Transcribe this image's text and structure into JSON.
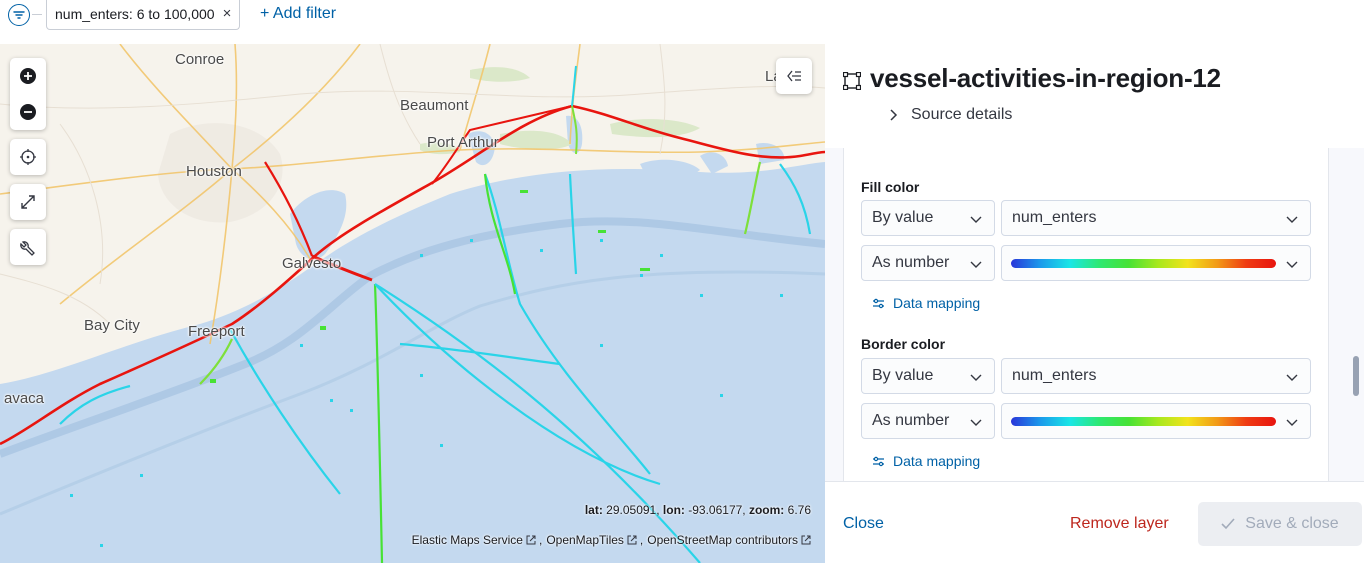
{
  "filter_bar": {
    "filter_pill": "num_enters: 6 to 100,000",
    "remove_symbol": "×",
    "add_filter": "+ Add filter"
  },
  "map": {
    "places": {
      "conroe": "Conroe",
      "beaumont": "Beaumont",
      "port_arthur": "Port Arthur",
      "houston": "Houston",
      "galveston": "Galvesto",
      "bay_city": "Bay City",
      "freeport": "Freeport",
      "lake_charles": "La",
      "palacios": "avaca"
    },
    "coords": {
      "lat_label": "lat:",
      "lat": "29.05091",
      "lon_label": "lon:",
      "lon": "-93.06177",
      "zoom_label": "zoom:",
      "zoom": "6.76"
    },
    "attribution": [
      "Elastic Maps Service",
      "OpenMapTiles",
      "OpenStreetMap contributors"
    ],
    "colors": {
      "water": "#c4d9ef",
      "land": "#f5f2ea",
      "track_high": "#e8150f",
      "track_low": "#2ad4e8"
    }
  },
  "panel": {
    "title": "vessel-activities-in-region-12",
    "source_details": "Source details",
    "fill_color": {
      "label": "Fill color",
      "mode": "By value",
      "field": "num_enters",
      "scale": "As number",
      "data_mapping": "Data mapping"
    },
    "border_color": {
      "label": "Border color",
      "mode": "By value",
      "field": "num_enters",
      "scale": "As number",
      "data_mapping": "Data mapping"
    },
    "footer": {
      "close": "Close",
      "remove_layer": "Remove layer",
      "save_close": "Save & close"
    }
  }
}
